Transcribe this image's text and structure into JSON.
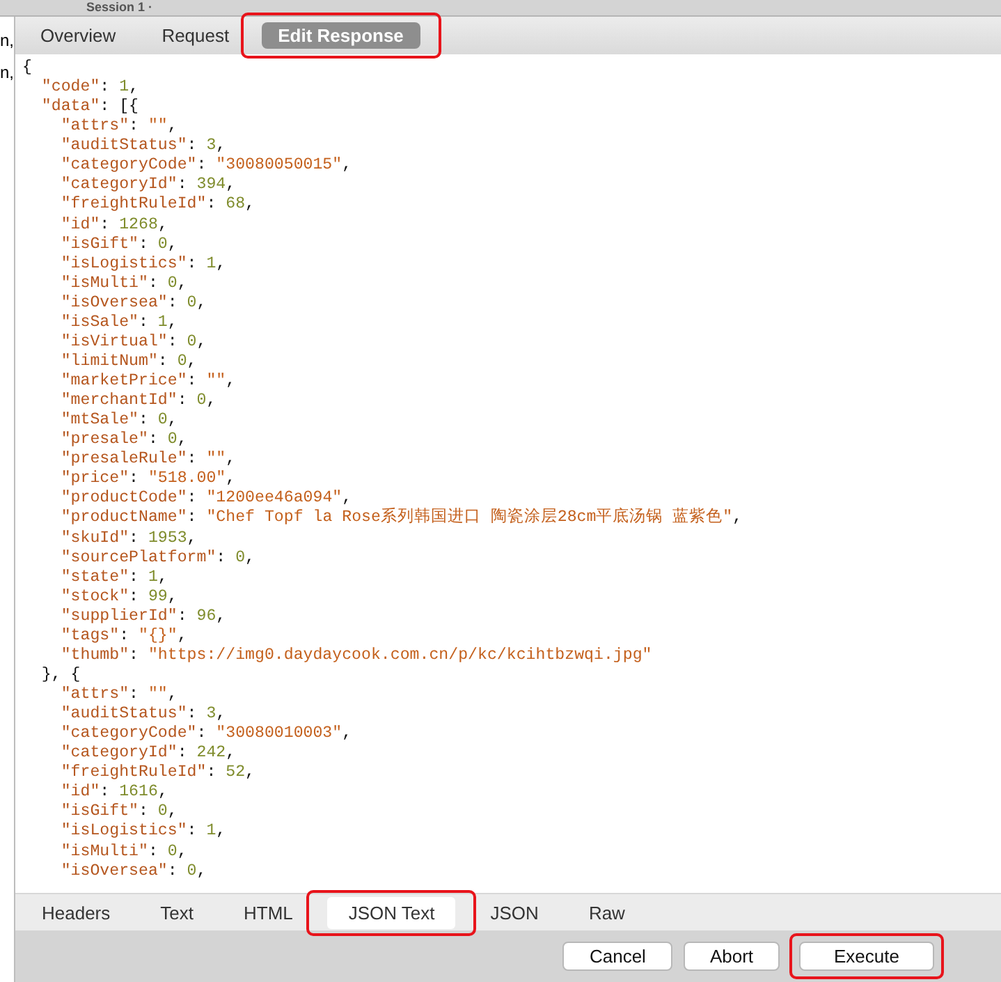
{
  "session_tab": {
    "title": "Session 1 ·"
  },
  "left_column": {
    "rows": [
      "n,",
      "n,"
    ]
  },
  "top_tabs": [
    {
      "label": "Overview",
      "selected": false,
      "highlighted": false
    },
    {
      "label": "Request",
      "selected": false,
      "highlighted": false
    },
    {
      "label": "Edit Response",
      "selected": true,
      "highlighted": true
    }
  ],
  "editor": {
    "lines": [
      [
        {
          "kind": "punct",
          "text": "{"
        }
      ],
      [
        {
          "kind": "key",
          "text": "  \"code\""
        },
        {
          "kind": "punct",
          "text": ": "
        },
        {
          "kind": "number",
          "text": "1"
        },
        {
          "kind": "punct",
          "text": ","
        }
      ],
      [
        {
          "kind": "key",
          "text": "  \"data\""
        },
        {
          "kind": "punct",
          "text": ": [{"
        }
      ],
      [
        {
          "kind": "key",
          "text": "    \"attrs\""
        },
        {
          "kind": "punct",
          "text": ": "
        },
        {
          "kind": "string",
          "text": "\"\""
        },
        {
          "kind": "punct",
          "text": ","
        }
      ],
      [
        {
          "kind": "key",
          "text": "    \"auditStatus\""
        },
        {
          "kind": "punct",
          "text": ": "
        },
        {
          "kind": "number",
          "text": "3"
        },
        {
          "kind": "punct",
          "text": ","
        }
      ],
      [
        {
          "kind": "key",
          "text": "    \"categoryCode\""
        },
        {
          "kind": "punct",
          "text": ": "
        },
        {
          "kind": "string",
          "text": "\"30080050015\""
        },
        {
          "kind": "punct",
          "text": ","
        }
      ],
      [
        {
          "kind": "key",
          "text": "    \"categoryId\""
        },
        {
          "kind": "punct",
          "text": ": "
        },
        {
          "kind": "number",
          "text": "394"
        },
        {
          "kind": "punct",
          "text": ","
        }
      ],
      [
        {
          "kind": "key",
          "text": "    \"freightRuleId\""
        },
        {
          "kind": "punct",
          "text": ": "
        },
        {
          "kind": "number",
          "text": "68"
        },
        {
          "kind": "punct",
          "text": ","
        }
      ],
      [
        {
          "kind": "key",
          "text": "    \"id\""
        },
        {
          "kind": "punct",
          "text": ": "
        },
        {
          "kind": "number",
          "text": "1268"
        },
        {
          "kind": "punct",
          "text": ","
        }
      ],
      [
        {
          "kind": "key",
          "text": "    \"isGift\""
        },
        {
          "kind": "punct",
          "text": ": "
        },
        {
          "kind": "number",
          "text": "0"
        },
        {
          "kind": "punct",
          "text": ","
        }
      ],
      [
        {
          "kind": "key",
          "text": "    \"isLogistics\""
        },
        {
          "kind": "punct",
          "text": ": "
        },
        {
          "kind": "number",
          "text": "1"
        },
        {
          "kind": "punct",
          "text": ","
        }
      ],
      [
        {
          "kind": "key",
          "text": "    \"isMulti\""
        },
        {
          "kind": "punct",
          "text": ": "
        },
        {
          "kind": "number",
          "text": "0"
        },
        {
          "kind": "punct",
          "text": ","
        }
      ],
      [
        {
          "kind": "key",
          "text": "    \"isOversea\""
        },
        {
          "kind": "punct",
          "text": ": "
        },
        {
          "kind": "number",
          "text": "0"
        },
        {
          "kind": "punct",
          "text": ","
        }
      ],
      [
        {
          "kind": "key",
          "text": "    \"isSale\""
        },
        {
          "kind": "punct",
          "text": ": "
        },
        {
          "kind": "number",
          "text": "1"
        },
        {
          "kind": "punct",
          "text": ","
        }
      ],
      [
        {
          "kind": "key",
          "text": "    \"isVirtual\""
        },
        {
          "kind": "punct",
          "text": ": "
        },
        {
          "kind": "number",
          "text": "0"
        },
        {
          "kind": "punct",
          "text": ","
        }
      ],
      [
        {
          "kind": "key",
          "text": "    \"limitNum\""
        },
        {
          "kind": "punct",
          "text": ": "
        },
        {
          "kind": "number",
          "text": "0"
        },
        {
          "kind": "punct",
          "text": ","
        }
      ],
      [
        {
          "kind": "key",
          "text": "    \"marketPrice\""
        },
        {
          "kind": "punct",
          "text": ": "
        },
        {
          "kind": "string",
          "text": "\"\""
        },
        {
          "kind": "punct",
          "text": ","
        }
      ],
      [
        {
          "kind": "key",
          "text": "    \"merchantId\""
        },
        {
          "kind": "punct",
          "text": ": "
        },
        {
          "kind": "number",
          "text": "0"
        },
        {
          "kind": "punct",
          "text": ","
        }
      ],
      [
        {
          "kind": "key",
          "text": "    \"mtSale\""
        },
        {
          "kind": "punct",
          "text": ": "
        },
        {
          "kind": "number",
          "text": "0"
        },
        {
          "kind": "punct",
          "text": ","
        }
      ],
      [
        {
          "kind": "key",
          "text": "    \"presale\""
        },
        {
          "kind": "punct",
          "text": ": "
        },
        {
          "kind": "number",
          "text": "0"
        },
        {
          "kind": "punct",
          "text": ","
        }
      ],
      [
        {
          "kind": "key",
          "text": "    \"presaleRule\""
        },
        {
          "kind": "punct",
          "text": ": "
        },
        {
          "kind": "string",
          "text": "\"\""
        },
        {
          "kind": "punct",
          "text": ","
        }
      ],
      [
        {
          "kind": "key",
          "text": "    \"price\""
        },
        {
          "kind": "punct",
          "text": ": "
        },
        {
          "kind": "string",
          "text": "\"518.00\""
        },
        {
          "kind": "punct",
          "text": ","
        }
      ],
      [
        {
          "kind": "key",
          "text": "    \"productCode\""
        },
        {
          "kind": "punct",
          "text": ": "
        },
        {
          "kind": "string",
          "text": "\"1200ee46a094\""
        },
        {
          "kind": "punct",
          "text": ","
        }
      ],
      [
        {
          "kind": "key",
          "text": "    \"productName\""
        },
        {
          "kind": "punct",
          "text": ": "
        },
        {
          "kind": "string",
          "text": "\"Chef Topf la Rose系列韩国进口 陶瓷涂层28cm平底汤锅 蓝紫色\""
        },
        {
          "kind": "punct",
          "text": ","
        }
      ],
      [
        {
          "kind": "key",
          "text": "    \"skuId\""
        },
        {
          "kind": "punct",
          "text": ": "
        },
        {
          "kind": "number",
          "text": "1953"
        },
        {
          "kind": "punct",
          "text": ","
        }
      ],
      [
        {
          "kind": "key",
          "text": "    \"sourcePlatform\""
        },
        {
          "kind": "punct",
          "text": ": "
        },
        {
          "kind": "number",
          "text": "0"
        },
        {
          "kind": "punct",
          "text": ","
        }
      ],
      [
        {
          "kind": "key",
          "text": "    \"state\""
        },
        {
          "kind": "punct",
          "text": ": "
        },
        {
          "kind": "number",
          "text": "1"
        },
        {
          "kind": "punct",
          "text": ","
        }
      ],
      [
        {
          "kind": "key",
          "text": "    \"stock\""
        },
        {
          "kind": "punct",
          "text": ": "
        },
        {
          "kind": "number",
          "text": "99"
        },
        {
          "kind": "punct",
          "text": ","
        }
      ],
      [
        {
          "kind": "key",
          "text": "    \"supplierId\""
        },
        {
          "kind": "punct",
          "text": ": "
        },
        {
          "kind": "number",
          "text": "96"
        },
        {
          "kind": "punct",
          "text": ","
        }
      ],
      [
        {
          "kind": "key",
          "text": "    \"tags\""
        },
        {
          "kind": "punct",
          "text": ": "
        },
        {
          "kind": "string",
          "text": "\"{}\""
        },
        {
          "kind": "punct",
          "text": ","
        }
      ],
      [
        {
          "kind": "key",
          "text": "    \"thumb\""
        },
        {
          "kind": "punct",
          "text": ": "
        },
        {
          "kind": "string",
          "text": "\"https://img0.daydaycook.com.cn/p/kc/kcihtbzwqi.jpg\""
        }
      ],
      [
        {
          "kind": "punct",
          "text": "  }, {"
        }
      ],
      [
        {
          "kind": "key",
          "text": "    \"attrs\""
        },
        {
          "kind": "punct",
          "text": ": "
        },
        {
          "kind": "string",
          "text": "\"\""
        },
        {
          "kind": "punct",
          "text": ","
        }
      ],
      [
        {
          "kind": "key",
          "text": "    \"auditStatus\""
        },
        {
          "kind": "punct",
          "text": ": "
        },
        {
          "kind": "number",
          "text": "3"
        },
        {
          "kind": "punct",
          "text": ","
        }
      ],
      [
        {
          "kind": "key",
          "text": "    \"categoryCode\""
        },
        {
          "kind": "punct",
          "text": ": "
        },
        {
          "kind": "string",
          "text": "\"30080010003\""
        },
        {
          "kind": "punct",
          "text": ","
        }
      ],
      [
        {
          "kind": "key",
          "text": "    \"categoryId\""
        },
        {
          "kind": "punct",
          "text": ": "
        },
        {
          "kind": "number",
          "text": "242"
        },
        {
          "kind": "punct",
          "text": ","
        }
      ],
      [
        {
          "kind": "key",
          "text": "    \"freightRuleId\""
        },
        {
          "kind": "punct",
          "text": ": "
        },
        {
          "kind": "number",
          "text": "52"
        },
        {
          "kind": "punct",
          "text": ","
        }
      ],
      [
        {
          "kind": "key",
          "text": "    \"id\""
        },
        {
          "kind": "punct",
          "text": ": "
        },
        {
          "kind": "number",
          "text": "1616"
        },
        {
          "kind": "punct",
          "text": ","
        }
      ],
      [
        {
          "kind": "key",
          "text": "    \"isGift\""
        },
        {
          "kind": "punct",
          "text": ": "
        },
        {
          "kind": "number",
          "text": "0"
        },
        {
          "kind": "punct",
          "text": ","
        }
      ],
      [
        {
          "kind": "key",
          "text": "    \"isLogistics\""
        },
        {
          "kind": "punct",
          "text": ": "
        },
        {
          "kind": "number",
          "text": "1"
        },
        {
          "kind": "punct",
          "text": ","
        }
      ],
      [
        {
          "kind": "key",
          "text": "    \"isMulti\""
        },
        {
          "kind": "punct",
          "text": ": "
        },
        {
          "kind": "number",
          "text": "0"
        },
        {
          "kind": "punct",
          "text": ","
        }
      ],
      [
        {
          "kind": "key",
          "text": "    \"isOversea\""
        },
        {
          "kind": "punct",
          "text": ": "
        },
        {
          "kind": "number",
          "text": "0"
        },
        {
          "kind": "punct",
          "text": ","
        }
      ]
    ]
  },
  "bottom_tabs": [
    {
      "label": "Headers",
      "selected": false,
      "highlighted": false
    },
    {
      "label": "Text",
      "selected": false,
      "highlighted": false
    },
    {
      "label": "HTML",
      "selected": false,
      "highlighted": false
    },
    {
      "label": "JSON Text",
      "selected": true,
      "highlighted": true
    },
    {
      "label": "JSON",
      "selected": false,
      "highlighted": false
    },
    {
      "label": "Raw",
      "selected": false,
      "highlighted": false
    }
  ],
  "buttons": [
    {
      "label": "Cancel",
      "highlighted": false
    },
    {
      "label": "Abort",
      "highlighted": false
    },
    {
      "label": "Execute",
      "highlighted": true
    }
  ]
}
